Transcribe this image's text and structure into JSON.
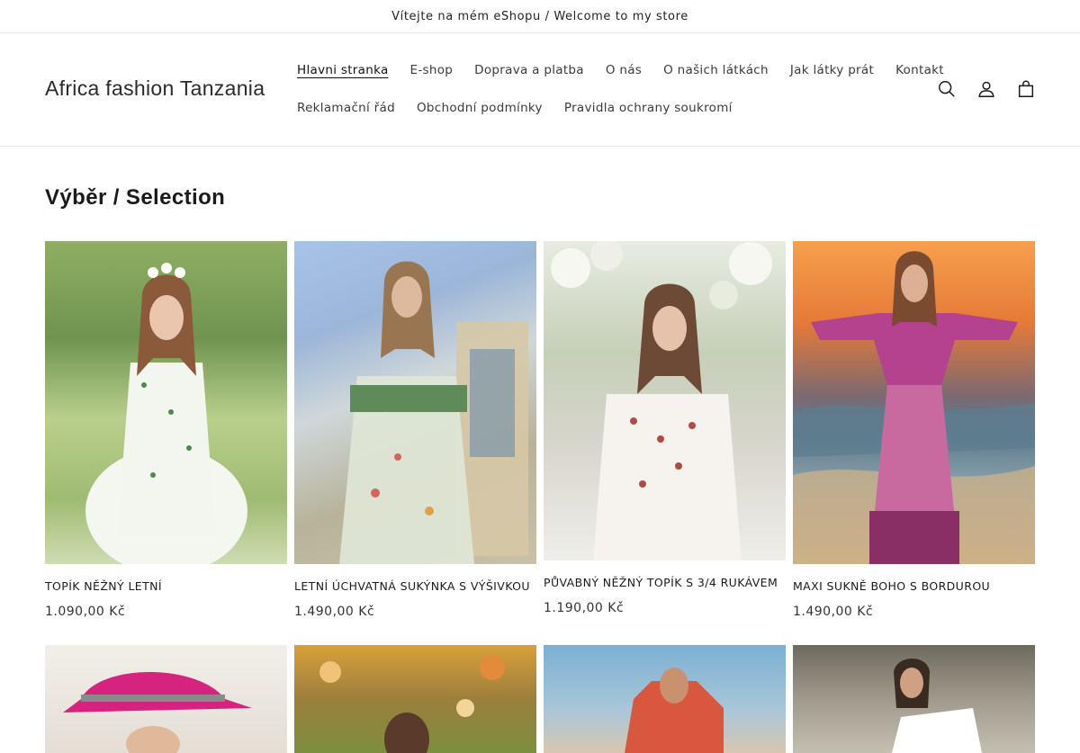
{
  "announcement": "Vítejte na mém eShopu / Welcome to my store",
  "header": {
    "logo": "Africa fashion Tanzania",
    "nav": [
      {
        "label": "Hlavni stranka",
        "active": true
      },
      {
        "label": "E-shop"
      },
      {
        "label": "Doprava a platba"
      },
      {
        "label": "O nás"
      },
      {
        "label": "O našich látkách"
      },
      {
        "label": "Jak látky prát"
      },
      {
        "label": "Kontakt"
      },
      {
        "label": "Reklamační řád"
      },
      {
        "label": "Obchodní podmínky"
      },
      {
        "label": "Pravidla ochrany soukromí"
      }
    ],
    "icons": [
      "search-icon",
      "account-icon",
      "cart-icon"
    ]
  },
  "section": {
    "title": "Výběr / Selection"
  },
  "products": [
    {
      "title": "TOPÍK NĚŽNÝ LETNÍ",
      "price": "1.090,00 Kč"
    },
    {
      "title": "LETNÍ ÚCHVATNÁ SUKÝNKA S VÝŠIVKOU",
      "price": "1.490,00 Kč"
    },
    {
      "title": "PŮVABNÝ NĚŽNÝ TOPÍK S 3/4 RUKÁVEM",
      "price": "1.190,00 Kč"
    },
    {
      "title": "MAXI SUKNĚ BOHO S BORDUROU",
      "price": "1.490,00 Kč"
    }
  ],
  "colors": {
    "text": "#121212",
    "border": "#e6e6e6",
    "background": "#ffffff"
  }
}
